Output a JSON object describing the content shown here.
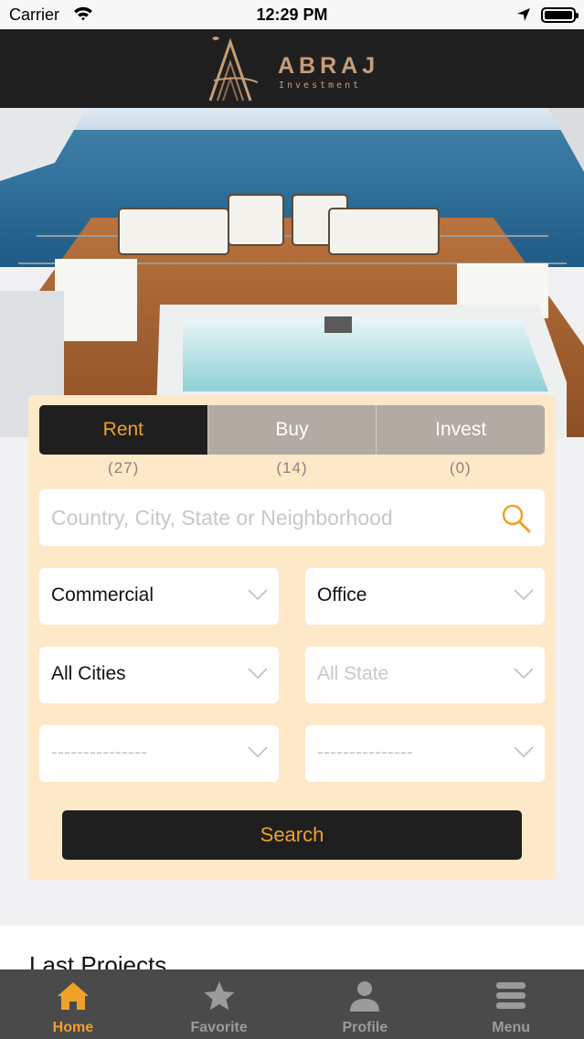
{
  "status_bar": {
    "carrier": "Carrier",
    "time": "12:29 PM"
  },
  "header": {
    "brand": "ABRAJ",
    "tagline": "Investment"
  },
  "colors": {
    "accent": "#f0a128",
    "dark": "#1f1f1f",
    "card_bg": "#fde8c8",
    "tab_inactive": "#b1aba3",
    "logo": "#c79d78"
  },
  "tabs": [
    {
      "label": "Rent",
      "count": "(27)",
      "active": true
    },
    {
      "label": "Buy",
      "count": "(14)",
      "active": false
    },
    {
      "label": "Invest",
      "count": "(0)",
      "active": false
    }
  ],
  "search": {
    "placeholder": "Country, City, State or Neighborhood",
    "value": ""
  },
  "filters": {
    "category": "Commercial",
    "type": "Office",
    "city": "All Cities",
    "state": "All State",
    "extra1": "---------------",
    "extra2": "---------------"
  },
  "search_button": "Search",
  "section": {
    "last_projects": "Last Projects"
  },
  "tabbar": [
    {
      "label": "Home",
      "icon": "home-icon",
      "active": true
    },
    {
      "label": "Favorite",
      "icon": "star-icon",
      "active": false
    },
    {
      "label": "Profile",
      "icon": "profile-icon",
      "active": false
    },
    {
      "label": "Menu",
      "icon": "menu-icon",
      "active": false
    }
  ]
}
